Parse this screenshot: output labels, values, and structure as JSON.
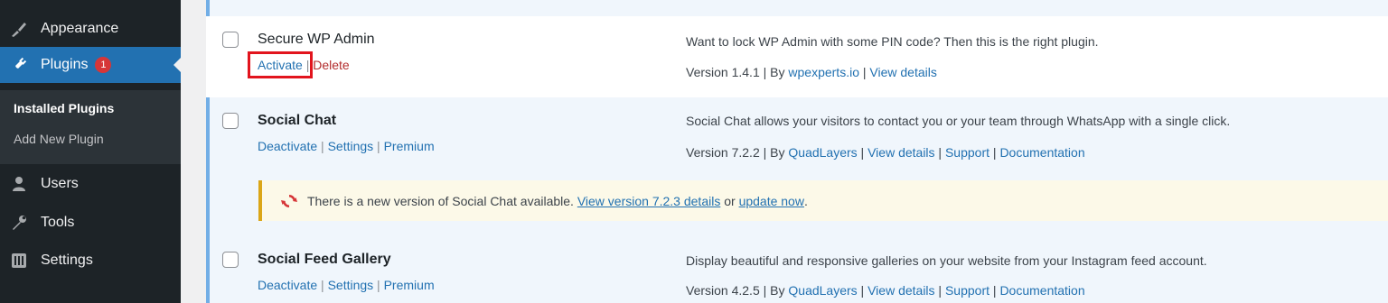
{
  "sidebar": {
    "items": [
      {
        "label": "Appearance",
        "icon": "brush-icon"
      },
      {
        "label": "Plugins",
        "icon": "plugin-icon",
        "badge": "1"
      },
      {
        "label": "Users",
        "icon": "user-icon"
      },
      {
        "label": "Tools",
        "icon": "wrench-icon"
      },
      {
        "label": "Settings",
        "icon": "settings-icon"
      }
    ],
    "submenu": [
      "Installed Plugins",
      "Add New Plugin"
    ]
  },
  "plugins": [
    {
      "name": "Secure WP Admin",
      "actions": [
        "Activate",
        "Delete"
      ],
      "description": "Want to lock WP Admin with some PIN code? Then this is the right plugin.",
      "version": "Version 1.4.1",
      "by": "By",
      "author": "wpexperts.io",
      "meta_links": [
        "View details"
      ]
    },
    {
      "name": "Social Chat",
      "actions": [
        "Deactivate",
        "Settings",
        "Premium"
      ],
      "description": "Social Chat allows your visitors to contact you or your team through WhatsApp with a single click.",
      "version": "Version 7.2.2",
      "by": "By",
      "author": "QuadLayers",
      "meta_links": [
        "View details",
        "Support",
        "Documentation"
      ]
    },
    {
      "name": "Social Feed Gallery",
      "actions": [
        "Deactivate",
        "Settings",
        "Premium"
      ],
      "description": "Display beautiful and responsive galleries on your website from your Instagram feed account.",
      "version": "Version 4.2.5",
      "by": "By",
      "author": "QuadLayers",
      "meta_links": [
        "View details",
        "Support",
        "Documentation"
      ]
    }
  ],
  "update_notice": {
    "text": "There is a new version of Social Chat available.",
    "view_link": "View version 7.2.3 details",
    "or": "or",
    "update_link": "update now",
    "period": "."
  },
  "colors": {
    "sidebar_bg": "#1d2327",
    "accent": "#2271b1",
    "highlight_box": "#e2141d",
    "badge": "#d63638"
  }
}
